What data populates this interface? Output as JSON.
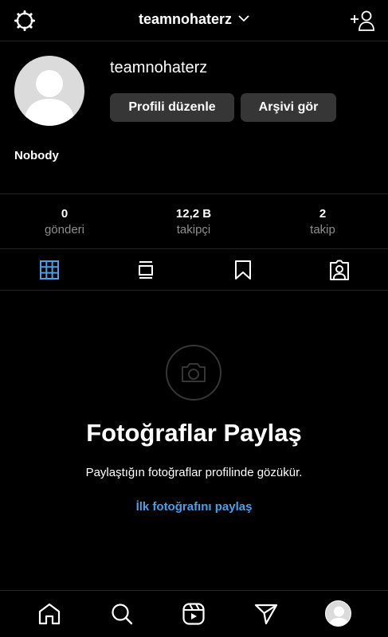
{
  "header": {
    "username": "teamnohaterz"
  },
  "profile": {
    "name": "teamnohaterz",
    "bio_name": "Nobody",
    "edit_profile_label": "Profili düzenle",
    "archive_label": "Arşivi gör"
  },
  "stats": [
    {
      "value": "0",
      "label": "gönderi"
    },
    {
      "value": "12,2 B",
      "label": "takipçi"
    },
    {
      "value": "2",
      "label": "takip"
    }
  ],
  "tabs": [
    {
      "icon": "grid-icon",
      "active": true
    },
    {
      "icon": "reels-feed-icon",
      "active": false
    },
    {
      "icon": "bookmark-icon",
      "active": false
    },
    {
      "icon": "tagged-icon",
      "active": false
    }
  ],
  "empty_state": {
    "title": "Fotoğraflar Paylaş",
    "subtitle": "Paylaştığın fotoğraflar profilinde gözükür.",
    "link": "İlk fotoğrafını paylaş"
  },
  "bottom_nav": [
    {
      "icon": "home-icon"
    },
    {
      "icon": "search-icon"
    },
    {
      "icon": "reels-icon"
    },
    {
      "icon": "direct-send-icon"
    },
    {
      "icon": "profile-avatar"
    }
  ],
  "colors": {
    "background": "#000000",
    "button": "#363636",
    "divider": "#262626",
    "muted": "#8e8e8e",
    "link": "#4a9fe8",
    "active_tab": "#4a9fe8"
  }
}
